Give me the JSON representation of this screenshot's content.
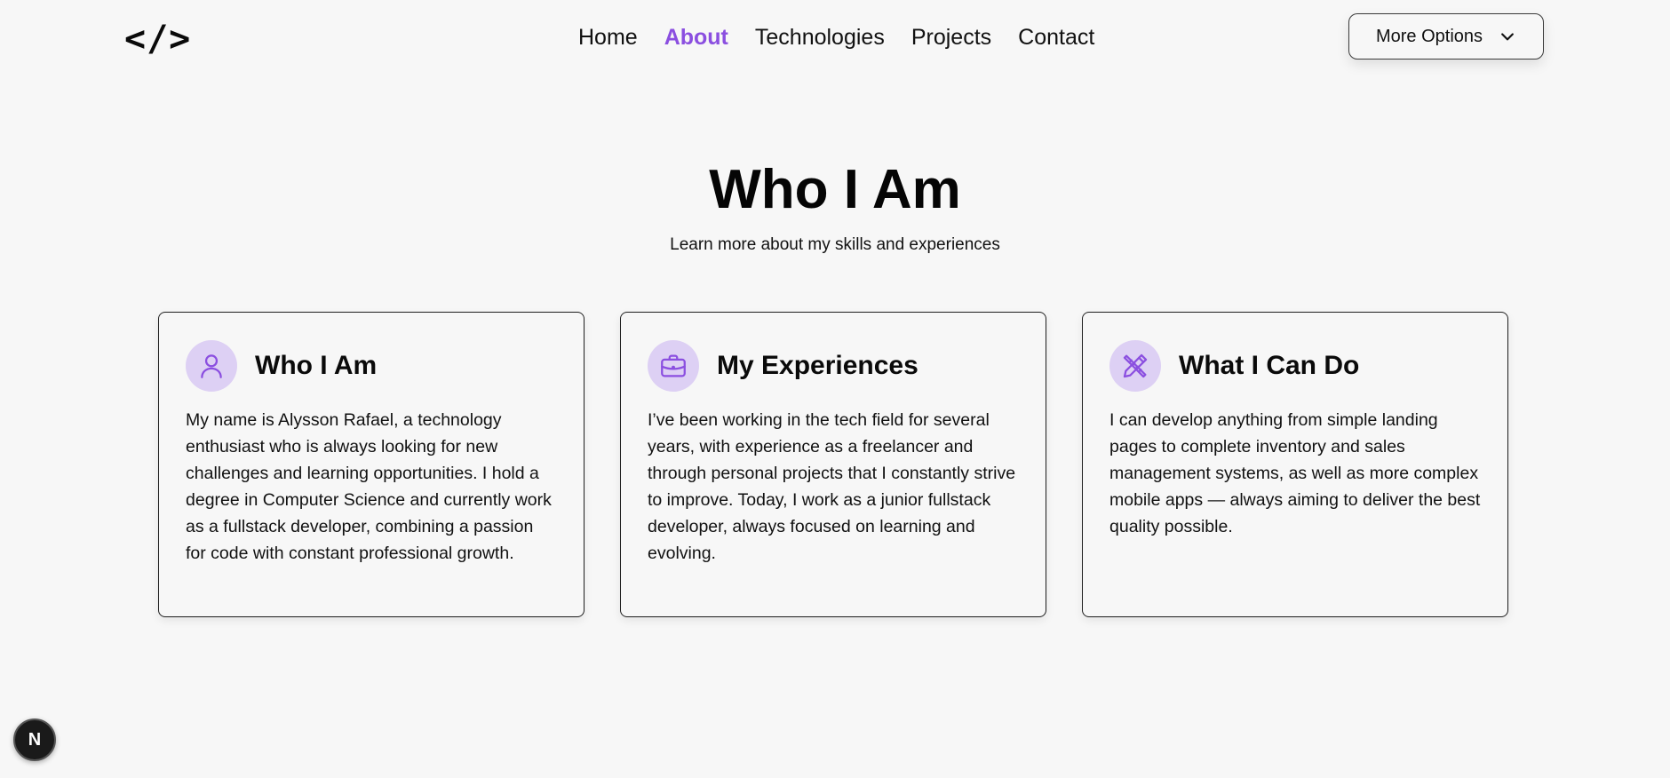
{
  "header": {
    "logo": "</>",
    "nav": [
      {
        "label": "Home",
        "active": false
      },
      {
        "label": "About",
        "active": true
      },
      {
        "label": "Technologies",
        "active": false
      },
      {
        "label": "Projects",
        "active": false
      },
      {
        "label": "Contact",
        "active": false
      }
    ],
    "more_options_label": "More Options",
    "more_options_icon": "chevron-down-icon"
  },
  "hero": {
    "title": "Who I Am",
    "subtitle": "Learn more about my skills and experiences"
  },
  "cards": [
    {
      "icon": "user-icon",
      "title": "Who I Am",
      "body": "My name is Alysson Rafael, a technology enthusiast who is always looking for new challenges and learning opportunities. I hold a degree in Computer Science and currently work as a fullstack developer, combining a passion for code with constant professional growth."
    },
    {
      "icon": "briefcase-icon",
      "title": "My Experiences",
      "body": "I’ve been working in the tech field for several years, with experience as a freelancer and through personal projects that I constantly strive to improve. Today, I work as a junior fullstack developer, always focused on learning and evolving."
    },
    {
      "icon": "pencil-ruler-icon",
      "title": "What I Can Do",
      "body": "I can develop anything from simple landing pages to complete inventory and sales management systems, as well as more complex mobile apps — always aiming to deliver the best quality possible."
    }
  ],
  "dev_badge": {
    "label": "N",
    "icon": "nextjs-icon"
  },
  "colors": {
    "accent": "#8b4fe0",
    "icon_bg": "#ddd0f4",
    "background": "#f7f7f7"
  }
}
